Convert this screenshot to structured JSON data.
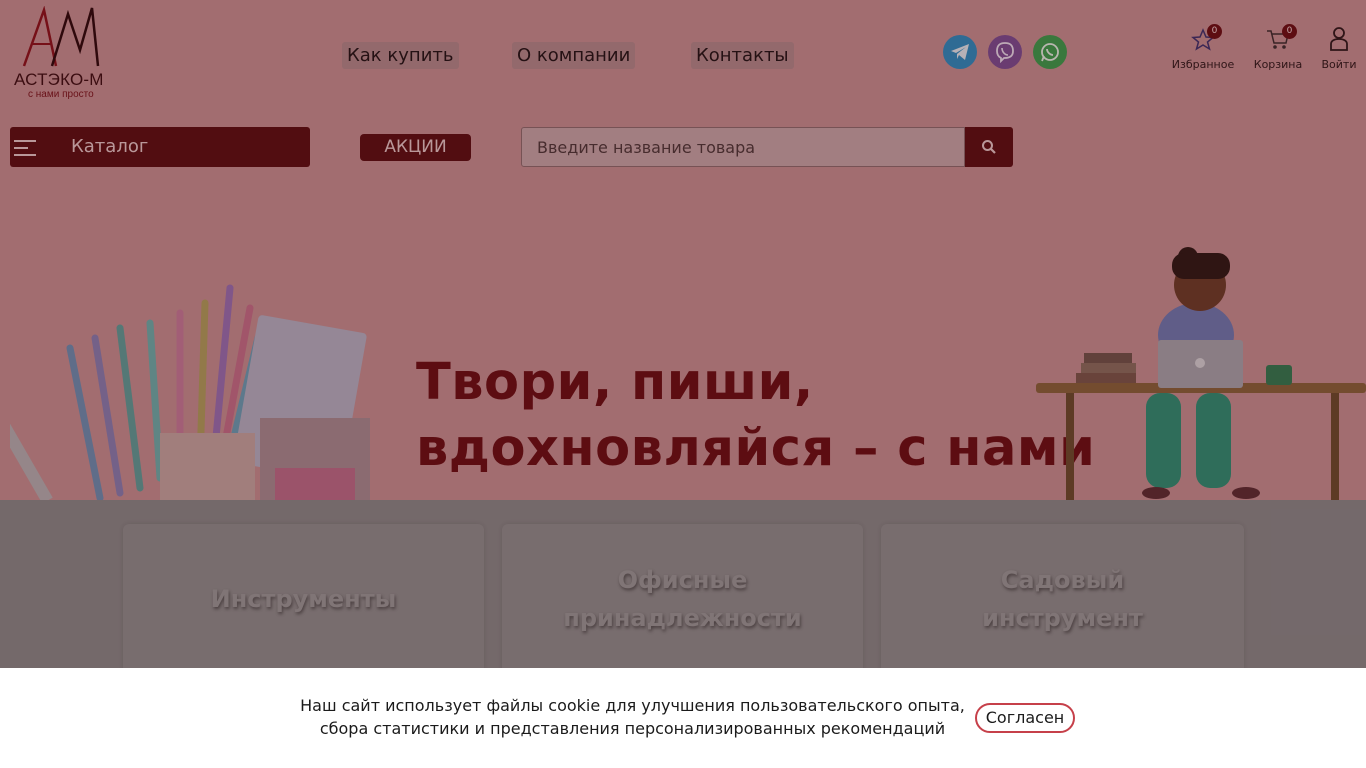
{
  "logo": {
    "name": "АСТЭКО-М",
    "slogan": "с нами просто"
  },
  "nav": [
    {
      "label": "Как купить"
    },
    {
      "label": "О компании"
    },
    {
      "label": "Контакты"
    }
  ],
  "header_icons": {
    "favorites": {
      "label": "Избранное",
      "count": "0"
    },
    "cart": {
      "label": "Корзина",
      "count": "0"
    },
    "login": {
      "label": "Войти"
    }
  },
  "catalog": {
    "label": "Каталог"
  },
  "promo": {
    "label": "АКЦИИ"
  },
  "search": {
    "placeholder": "Введите название товара"
  },
  "banner": {
    "line1": "Твори, пиши,",
    "line2": "вдохновляйся – с нами"
  },
  "categories": [
    {
      "label": "Инструменты"
    },
    {
      "label": "Офисные принадлежности"
    },
    {
      "label": "Садовый инструмент"
    }
  ],
  "cookie": {
    "text_line1": "Наш сайт использует файлы cookie для улучшения пользовательского опыта,",
    "text_line2": "сбора статистики и представления персонализированных рекомендаций",
    "button": "Согласен"
  },
  "colors": {
    "brand": "#6a0a10",
    "accent": "#c6404a"
  }
}
